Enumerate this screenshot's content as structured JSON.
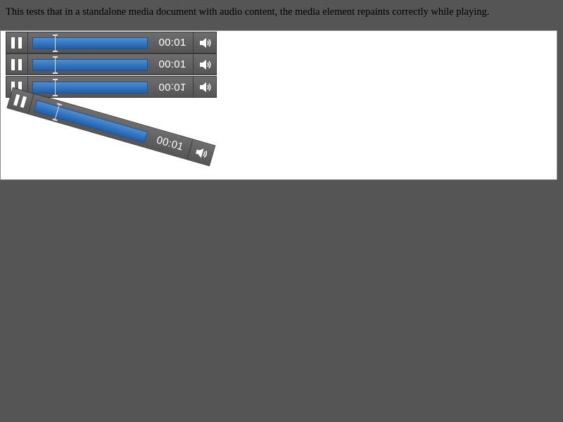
{
  "page": {
    "description": "This tests that in a standalone media document with audio content, the media element repaints correctly while playing."
  },
  "players": [
    {
      "state": "playing",
      "time": "00:01",
      "progress": 0.19,
      "button_icon": "pause-icon",
      "volume_icon": "speaker-icon"
    },
    {
      "state": "playing",
      "time": "00:01",
      "progress": 0.19,
      "button_icon": "pause-icon",
      "volume_icon": "speaker-icon"
    },
    {
      "state": "playing",
      "time": "00:01",
      "progress": 0.19,
      "button_icon": "pause-icon",
      "volume_icon": "speaker-icon",
      "transform": "flipped vertically"
    },
    {
      "state": "playing",
      "time": "00:01",
      "progress": 0.19,
      "button_icon": "pause-icon",
      "volume_icon": "speaker-icon",
      "transform": "rotated"
    }
  ],
  "colors": {
    "page_background": "#555555",
    "frame_background": "#ffffff",
    "controls_background": "#5e5e5e",
    "timeline_fill": "#2f74c0",
    "text": "#ffffff"
  }
}
